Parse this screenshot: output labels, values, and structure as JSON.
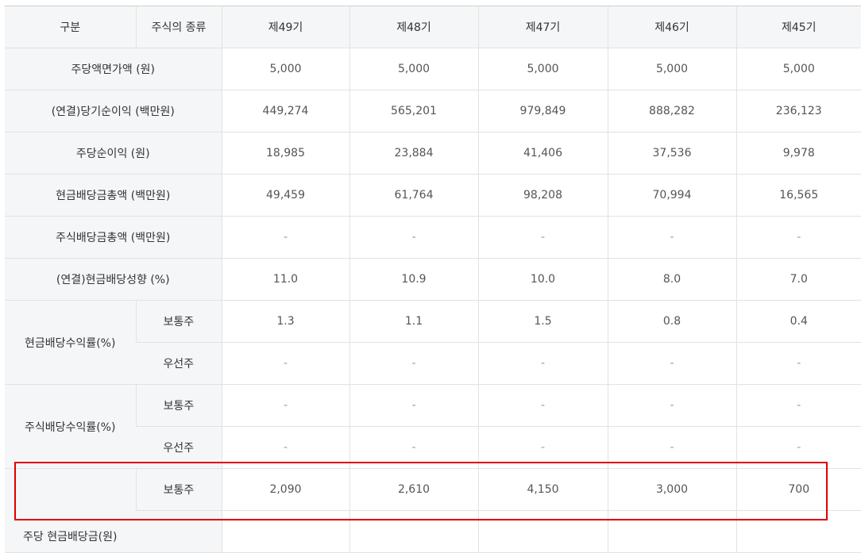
{
  "header": {
    "col_category": "구분",
    "col_stock_type": "주식의 종류",
    "periods": [
      "제49기",
      "제48기",
      "제47기",
      "제46기",
      "제45기"
    ]
  },
  "rows": {
    "par_value": {
      "label": "주당액면가액 (원)",
      "values": [
        "5,000",
        "5,000",
        "5,000",
        "5,000",
        "5,000"
      ]
    },
    "net_income": {
      "label": "(연결)당기순이익 (백만원)",
      "values": [
        "449,274",
        "565,201",
        "979,849",
        "888,282",
        "236,123"
      ]
    },
    "eps": {
      "label": "주당순이익 (원)",
      "values": [
        "18,985",
        "23,884",
        "41,406",
        "37,536",
        "9,978"
      ]
    },
    "cash_div_total": {
      "label": "현금배당금총액 (백만원)",
      "values": [
        "49,459",
        "61,764",
        "98,208",
        "70,994",
        "16,565"
      ]
    },
    "stock_div_total": {
      "label": "주식배당금총액 (백만원)",
      "values": [
        "-",
        "-",
        "-",
        "-",
        "-"
      ]
    },
    "payout_ratio": {
      "label": "(연결)현금배당성향 (%)",
      "values": [
        "11.0",
        "10.9",
        "10.0",
        "8.0",
        "7.0"
      ]
    },
    "cash_yield": {
      "label": "현금배당수익률(%)",
      "common": {
        "label": "보통주",
        "values": [
          "1.3",
          "1.1",
          "1.5",
          "0.8",
          "0.4"
        ]
      },
      "preferred": {
        "label": "우선주",
        "values": [
          "-",
          "-",
          "-",
          "-",
          "-"
        ]
      }
    },
    "stock_yield": {
      "label": "주식배당수익률(%)",
      "common": {
        "label": "보통주",
        "values": [
          "-",
          "-",
          "-",
          "-",
          "-"
        ]
      },
      "preferred": {
        "label": "우선주",
        "values": [
          "-",
          "-",
          "-",
          "-",
          "-"
        ]
      }
    },
    "dps": {
      "label": "주당 현금배당금(원)",
      "common": {
        "label": "보통주",
        "values": [
          "2,090",
          "2,610",
          "4,150",
          "3,000",
          "700"
        ]
      }
    }
  },
  "highlight_color": "#e00000"
}
